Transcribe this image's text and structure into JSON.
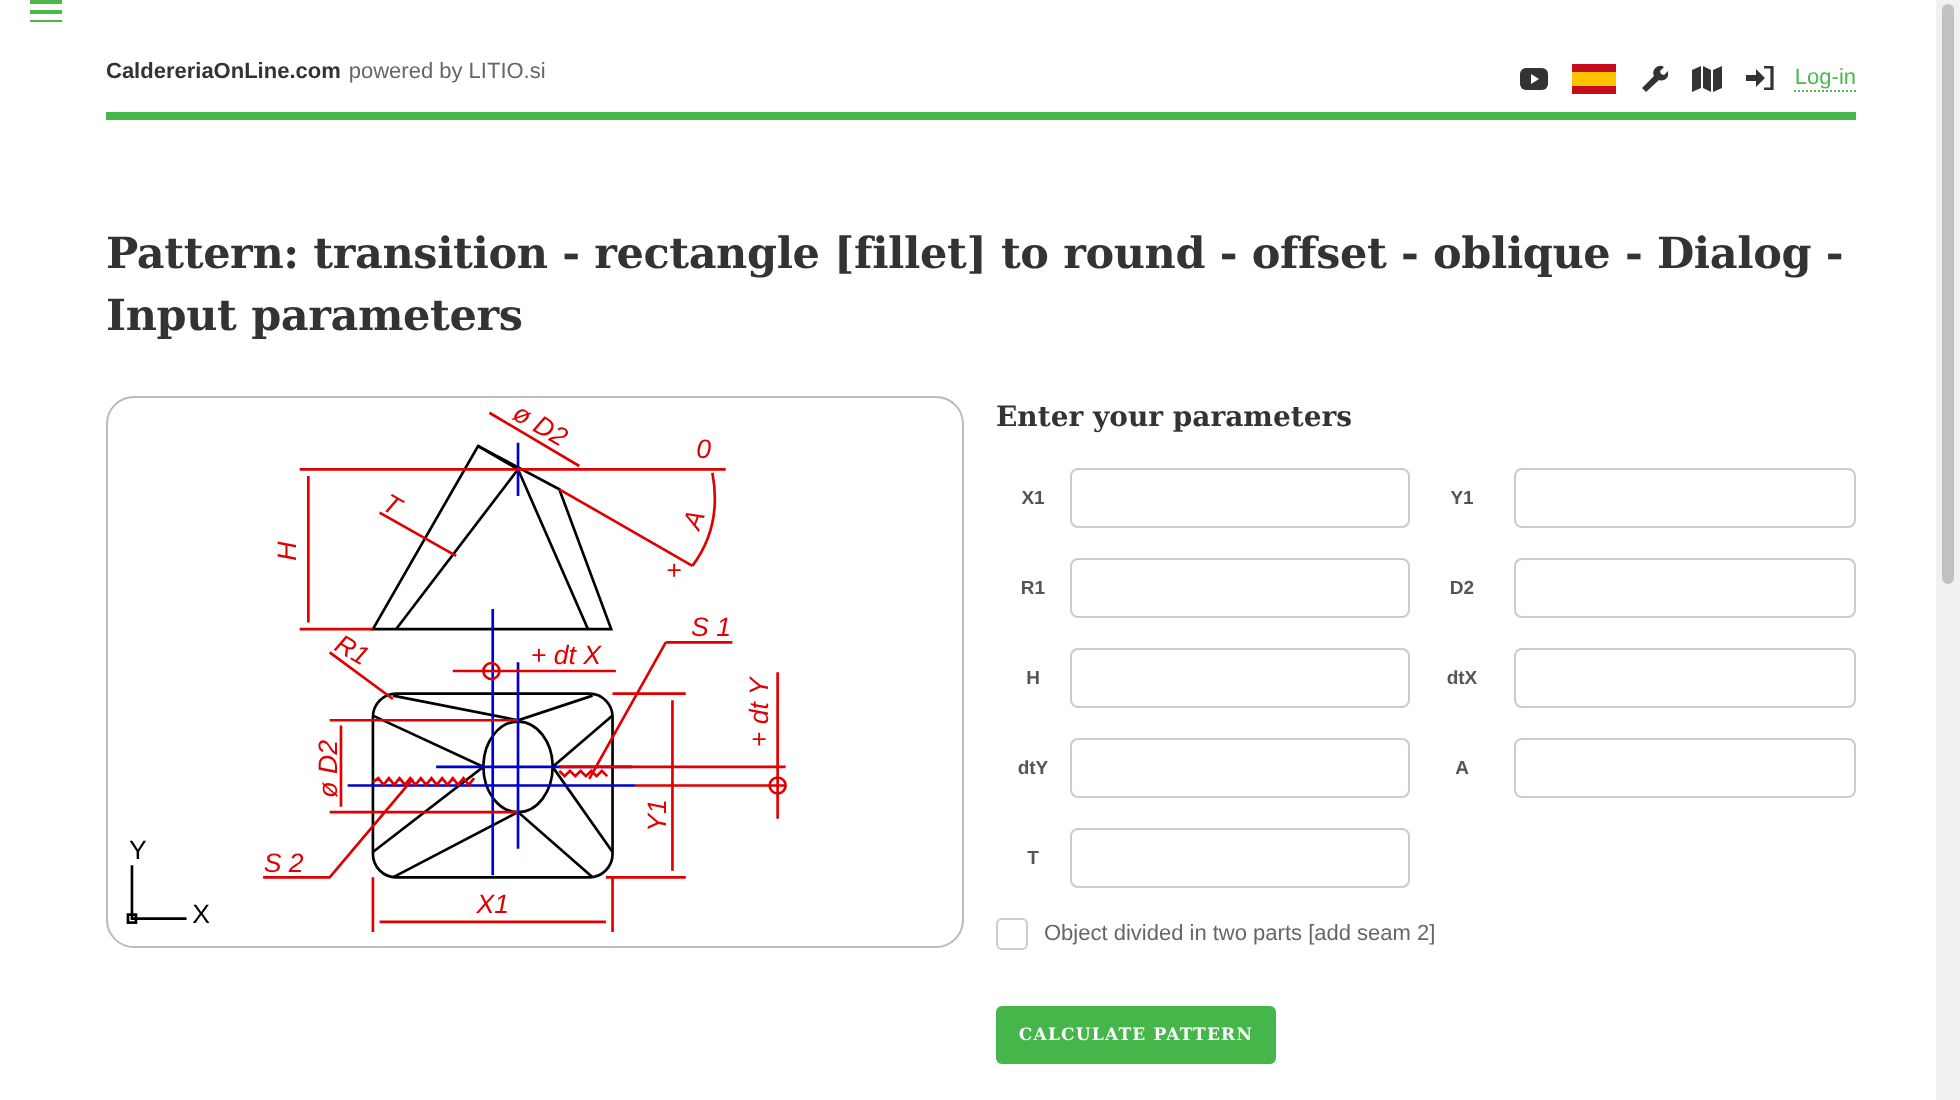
{
  "header": {
    "site": "CaldereriaOnLine.com",
    "powered_by": "powered by LITIO.si",
    "login": "Log-in"
  },
  "title": "Pattern: transition - rectangle [fillet] to round - offset - oblique - Dialog - Input parameters",
  "drawing": {
    "labels": [
      {
        "text": "ø D2"
      },
      {
        "text": "0"
      },
      {
        "text": "A"
      },
      {
        "text": "+"
      },
      {
        "text": "T"
      },
      {
        "text": "H"
      },
      {
        "text": "R1"
      },
      {
        "text": "+ dt X"
      },
      {
        "text": "S 1"
      },
      {
        "text": "ø D2"
      },
      {
        "text": "+ dt Y"
      },
      {
        "text": "Y1"
      },
      {
        "text": "S 2"
      },
      {
        "text": "X1"
      },
      {
        "text": "Y"
      },
      {
        "text": "X"
      }
    ]
  },
  "form": {
    "heading": "Enter your parameters",
    "fields": [
      {
        "label": "X1"
      },
      {
        "label": "Y1"
      },
      {
        "label": "R1"
      },
      {
        "label": "D2"
      },
      {
        "label": "H"
      },
      {
        "label": "dtX"
      },
      {
        "label": "dtY"
      },
      {
        "label": "A"
      },
      {
        "label": "T"
      }
    ],
    "checkbox": {
      "label": "Object divided in two parts [add seam 2]",
      "checked": false
    },
    "submit": "CALCULATE PATTERN"
  }
}
